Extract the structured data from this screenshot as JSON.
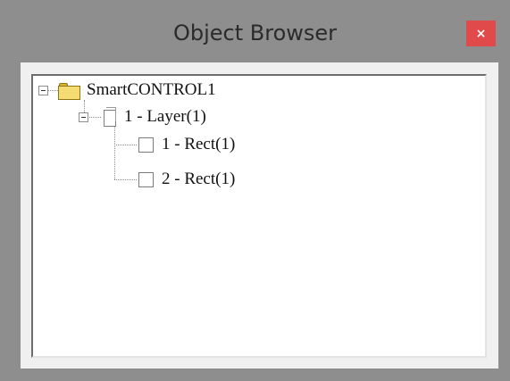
{
  "window": {
    "title": "Object Browser",
    "close_label": "×"
  },
  "tree": {
    "root": {
      "label": "SmartCONTROL1",
      "icon": "folder-icon",
      "expanded": true
    },
    "layer": {
      "label": "1 - Layer(1)",
      "icon": "page-icon",
      "expanded": true
    },
    "children": [
      {
        "label": "1 - Rect(1)",
        "icon": "rect-icon"
      },
      {
        "label": "2 - Rect(1)",
        "icon": "rect-icon"
      }
    ]
  },
  "colors": {
    "window_bg": "#8e8e8e",
    "close_button": "#e04a4a",
    "panel_bg": "#ffffff",
    "folder": "#f5dc72"
  }
}
